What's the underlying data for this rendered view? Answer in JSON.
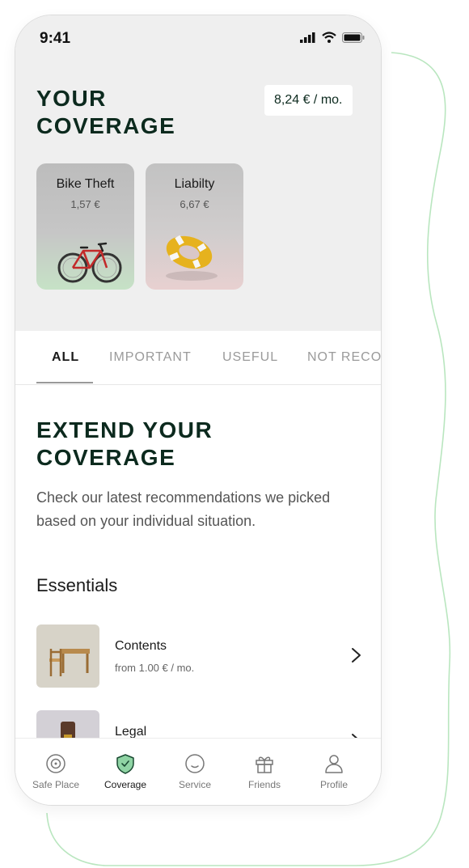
{
  "status": {
    "time": "9:41"
  },
  "header": {
    "title_line1": "YOUR",
    "title_line2": "COVERAGE",
    "total_price": "8,24 € / mo."
  },
  "coverage_cards": [
    {
      "title": "Bike Theft",
      "price": "1,57 €",
      "icon": "bicycle-icon"
    },
    {
      "title": "Liabilty",
      "price": "6,67 €",
      "icon": "lifebuoy-icon"
    }
  ],
  "tabs": [
    {
      "label": "ALL",
      "active": true
    },
    {
      "label": "IMPORTANT"
    },
    {
      "label": "USEFUL"
    },
    {
      "label": "NOT RECO"
    }
  ],
  "extend": {
    "title_line1": "EXTEND YOUR",
    "title_line2": "COVERAGE",
    "description": "Check our latest recommendations we picked based on your individual situation."
  },
  "essentials": {
    "title": "Essentials",
    "items": [
      {
        "title": "Contents",
        "subtitle": "from 1.00 € / mo.",
        "icon": "furniture-thumbnail"
      },
      {
        "title": "Legal",
        "subtitle": "",
        "icon": "gavel-thumbnail"
      }
    ]
  },
  "bottom_nav": [
    {
      "label": "Safe Place",
      "icon": "safe-dial-icon"
    },
    {
      "label": "Coverage",
      "icon": "shield-check-icon",
      "active": true
    },
    {
      "label": "Service",
      "icon": "smile-icon"
    },
    {
      "label": "Friends",
      "icon": "gift-icon"
    },
    {
      "label": "Profile",
      "icon": "person-icon"
    }
  ],
  "colors": {
    "brand_dark": "#0c2a1e",
    "accent_green": "#2e9a5a",
    "wave_line": "#b9e6bf"
  }
}
